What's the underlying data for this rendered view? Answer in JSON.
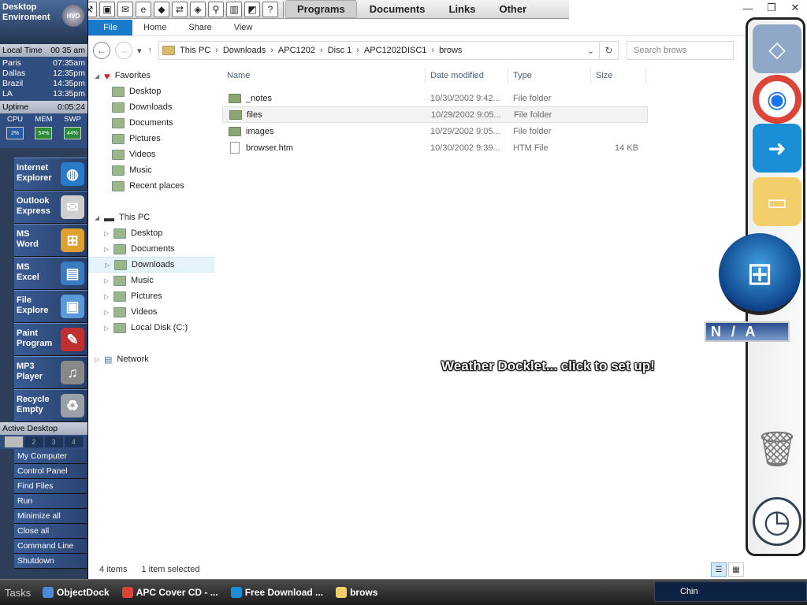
{
  "toolbar": {
    "icons": [
      "paint-icon",
      "pencil-icon",
      "plus-icon",
      "calculator-icon",
      "tools-icon",
      "image-icon",
      "package-icon",
      "ie-icon",
      "editor-icon",
      "network-icon",
      "cube-icon",
      "runner-icon",
      "book-icon",
      "library-icon",
      "help-icon"
    ],
    "icon_glyphs": [
      "✎",
      "✏",
      "✚",
      "▦",
      "⚒",
      "▣",
      "✉",
      "e",
      "◆",
      "⇄",
      "◈",
      "⚲",
      "▥",
      "◩",
      "?"
    ],
    "menus": [
      "Programs",
      "Documents",
      "Links",
      "Other"
    ]
  },
  "window": {
    "minimize": "—",
    "maximize": "❐",
    "close": "✕"
  },
  "sidebar": {
    "title": "Desktop Enviroment",
    "hvd": "HVD",
    "local_time_label": "Local Time",
    "local_time": "00 35 am",
    "cities": [
      {
        "name": "Paris",
        "time": "07:35am"
      },
      {
        "name": "Dallas",
        "time": "12:35pm"
      },
      {
        "name": "Brazil",
        "time": "14:35pm"
      },
      {
        "name": "LA",
        "time": "13:35pm"
      }
    ],
    "uptime_label": "Uptime",
    "uptime": "0:05:24",
    "meters": [
      {
        "label": "CPU",
        "value": "2%",
        "color": "#2a5aa0"
      },
      {
        "label": "MEM",
        "value": "54%",
        "color": "#2c8a3a"
      },
      {
        "label": "SWP",
        "value": "44%",
        "color": "#2c8a3a"
      }
    ],
    "apps": [
      {
        "line1": "Internet",
        "line2": "Explorer",
        "glyph": "◍",
        "color": "#2a7ac9"
      },
      {
        "line1": "Outlook",
        "line2": "Express",
        "glyph": "✉",
        "color": "#cfcfcf"
      },
      {
        "line1": "MS",
        "line2": "Word",
        "glyph": "⊞",
        "color": "#e0a030"
      },
      {
        "line1": "MS",
        "line2": "Excel",
        "glyph": "▤",
        "color": "#3a7ac0"
      },
      {
        "line1": "File",
        "line2": "Explore",
        "glyph": "▣",
        "color": "#5a9ad8"
      },
      {
        "line1": "Paint",
        "line2": "Program",
        "glyph": "✎",
        "color": "#c03030"
      },
      {
        "line1": "MP3",
        "line2": "Player",
        "glyph": "♫",
        "color": "#888"
      },
      {
        "line1": "Recycle",
        "line2": "Empty",
        "glyph": "♻",
        "color": "#9aa0a8"
      }
    ],
    "active_desktop_label": "Active Desktop",
    "pages": [
      "",
      "2",
      "3",
      "4"
    ],
    "quick": [
      "My Computer",
      "Control Panel",
      "Find Files",
      "Run",
      "Minimize all",
      "Close all",
      "Command Line",
      "Shutdown"
    ]
  },
  "explorer": {
    "ribbon_tabs": [
      "File",
      "Home",
      "Share",
      "View"
    ],
    "breadcrumb": [
      "This PC",
      "Downloads",
      "APC1202",
      "Disc 1",
      "APC1202DISC1",
      "brows"
    ],
    "search_placeholder": "Search brows",
    "favorites_label": "Favorites",
    "favorites": [
      "Desktop",
      "Downloads",
      "Documents",
      "Pictures",
      "Videos",
      "Music",
      "Recent places"
    ],
    "thispc_label": "This PC",
    "thispc": [
      "Desktop",
      "Documents",
      "Downloads",
      "Music",
      "Pictures",
      "Videos",
      "Local Disk (C:)"
    ],
    "selected_nav": "Downloads",
    "network_label": "Network",
    "columns": [
      "Name",
      "Date modified",
      "Type",
      "Size"
    ],
    "files": [
      {
        "name": "_notes",
        "date": "10/30/2002 9:42...",
        "type": "File folder",
        "size": "",
        "kind": "folder"
      },
      {
        "name": "files",
        "date": "10/29/2002 9:05...",
        "type": "File folder",
        "size": "",
        "kind": "folder"
      },
      {
        "name": "images",
        "date": "10/29/2002 9:05...",
        "type": "File folder",
        "size": "",
        "kind": "folder"
      },
      {
        "name": "browser.htm",
        "date": "10/30/2002 9:39...",
        "type": "HTM File",
        "size": "14 KB",
        "kind": "file"
      }
    ],
    "selected_file": "files",
    "status_items": "4 items",
    "status_selected": "1 item selected"
  },
  "dock": {
    "items": [
      {
        "name": "dock-app-icon",
        "glyph": "◇",
        "color": "#8fa8c8"
      },
      {
        "name": "chrome-icon",
        "glyph": "◉",
        "color": "#ffffff"
      },
      {
        "name": "download-app-icon",
        "glyph": "➜",
        "color": "#1a8fd8"
      },
      {
        "name": "file-explorer-icon",
        "glyph": "▭",
        "color": "#f2cf6a"
      }
    ],
    "start_glyph": "⊞",
    "weather_badge": "N / A",
    "weather_text": "Weather Docklet... click to set up!",
    "recycle_glyph": "🗑",
    "clock_glyph": "◷"
  },
  "taskbar": {
    "tasks_label": "Tasks",
    "tasks": [
      {
        "label": "ObjectDock",
        "color": "#4a8ad8"
      },
      {
        "label": "APC Cover CD - ...",
        "color": "#db4437"
      },
      {
        "label": "Free Download ...",
        "color": "#1a8fd8"
      },
      {
        "label": "brows",
        "color": "#f2cf6a"
      }
    ],
    "tray_text": "Chin"
  }
}
